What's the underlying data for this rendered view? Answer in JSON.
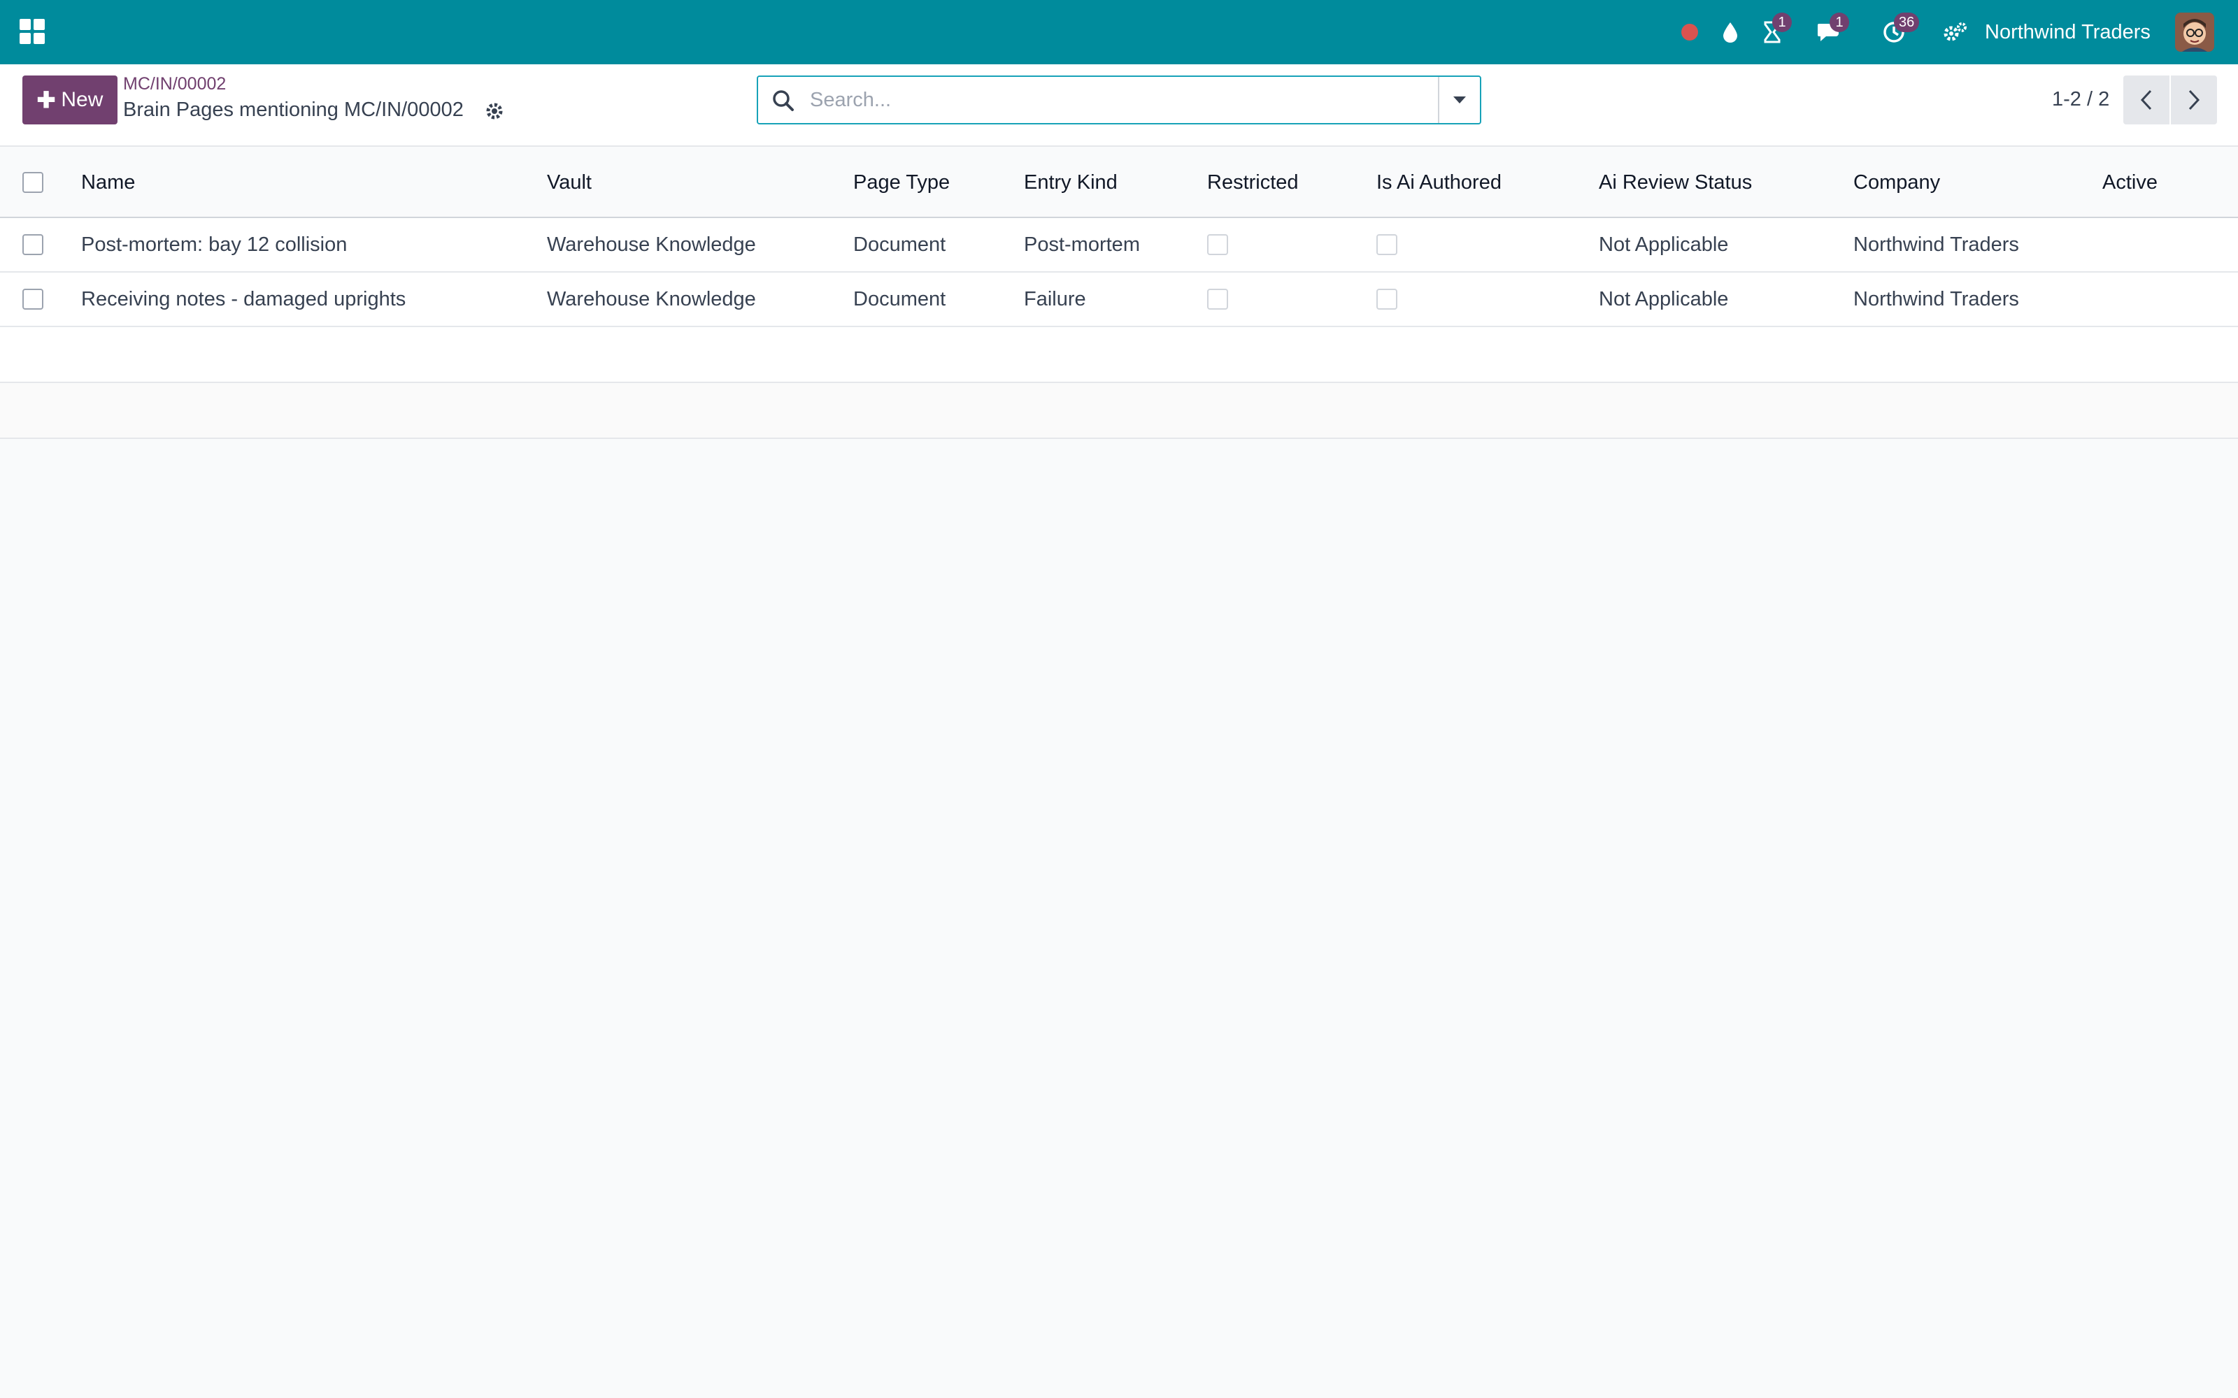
{
  "navbar": {
    "icons": [
      "apps-icon",
      "record-icon",
      "drop-icon",
      "hourglass-icon",
      "chat-icon",
      "clock-icon",
      "settings-icon"
    ],
    "activities_badge": "1",
    "messages_badge": "1",
    "clock_badge": "36",
    "company_name": "Northwind Traders",
    "accent_color": "#008b9c",
    "badge_color": "#71406f"
  },
  "control_panel": {
    "new_label": "New",
    "breadcrumb_parent": "MC/IN/00002",
    "page_title": "Brain Pages mentioning MC/IN/00002",
    "search_placeholder": "Search...",
    "pager_value": "1-2 / 2"
  },
  "list": {
    "columns": [
      "Name",
      "Vault",
      "Page Type",
      "Entry Kind",
      "Restricted",
      "Is Ai Authored",
      "Ai Review Status",
      "Company",
      "Active"
    ],
    "rows": [
      {
        "name": "Post-mortem: bay 12 collision",
        "vault": "Warehouse Knowledge",
        "page_type": "Document",
        "entry_kind": "Post-mortem",
        "restricted": false,
        "is_ai_authored": false,
        "ai_review_status": "Not Applicable",
        "company": "Northwind Traders",
        "active": ""
      },
      {
        "name": "Receiving notes - damaged uprights",
        "vault": "Warehouse Knowledge",
        "page_type": "Document",
        "entry_kind": "Failure",
        "restricted": false,
        "is_ai_authored": false,
        "ai_review_status": "Not Applicable",
        "company": "Northwind Traders",
        "active": ""
      }
    ]
  }
}
